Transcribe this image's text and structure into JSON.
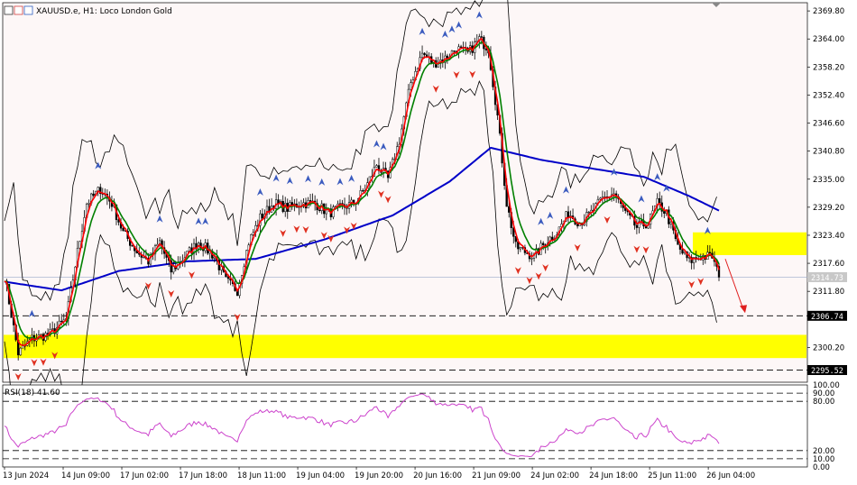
{
  "header": {
    "symbol_title": "XAUUSD.e, H1:  Loco London Gold"
  },
  "colors": {
    "price_bg": "#fdf7f7",
    "bull_candle": "#000000",
    "ma_fast": "#ff0000",
    "ma_slow": "#008000",
    "ma_long": "#0000c8",
    "bands": "#000000",
    "zone": "#ffff00",
    "rsi_line": "#cc44cc",
    "fractal_up": "#3b5bbf",
    "fractal_down": "#e03020",
    "forecast_arrow": "#e02020"
  },
  "chart_data": {
    "type": "candlestick",
    "symbol": "XAUUSD.e",
    "timeframe": "H1",
    "title": "Loco London Gold",
    "ylim": [
      2293.0,
      2371.5
    ],
    "y_ticks": [
      "2369.80",
      "2364.00",
      "2358.20",
      "2352.40",
      "2346.60",
      "2340.80",
      "2335.00",
      "2329.20",
      "2323.40",
      "2317.60",
      "2311.80",
      "2300.20"
    ],
    "x_ticks": [
      "13 Jun 2024",
      "14 Jun 09:00",
      "17 Jun 02:00",
      "17 Jun 18:00",
      "18 Jun 11:00",
      "19 Jun 04:00",
      "19 Jun 20:00",
      "20 Jun 16:00",
      "21 Jun 09:00",
      "24 Jun 02:00",
      "24 Jun 18:00",
      "25 Jun 11:00",
      "26 Jun 04:00"
    ],
    "current_price": "2314.73",
    "horizontal_levels": [
      {
        "label": "2306.74",
        "value": 2306.74,
        "style": "dashed"
      },
      {
        "label": "2295.52",
        "value": 2295.52,
        "style": "dashed"
      }
    ],
    "zones": [
      {
        "from": 2298.0,
        "to": 2302.8
      },
      {
        "from": 2319.3,
        "to": 2324.0
      }
    ],
    "price_path": [
      [
        0,
        2315.0
      ],
      [
        6,
        2299.0
      ],
      [
        12,
        2302.0
      ],
      [
        20,
        2303.0
      ],
      [
        27,
        2306.0
      ],
      [
        32,
        2320.0
      ],
      [
        36,
        2330.0
      ],
      [
        42,
        2333.0
      ],
      [
        47,
        2330.0
      ],
      [
        52,
        2324.0
      ],
      [
        58,
        2320.0
      ],
      [
        63,
        2318.0
      ],
      [
        68,
        2322.0
      ],
      [
        73,
        2316.0
      ],
      [
        79,
        2319.0
      ],
      [
        85,
        2322.0
      ],
      [
        92,
        2319.0
      ],
      [
        97,
        2314.0
      ],
      [
        102,
        2312.0
      ],
      [
        107,
        2322.0
      ],
      [
        112,
        2327.0
      ],
      [
        118,
        2330.0
      ],
      [
        124,
        2329.0
      ],
      [
        130,
        2330.0
      ],
      [
        136,
        2330.0
      ],
      [
        142,
        2328.0
      ],
      [
        147,
        2329.0
      ],
      [
        153,
        2330.0
      ],
      [
        158,
        2333.0
      ],
      [
        163,
        2338.0
      ],
      [
        168,
        2335.0
      ],
      [
        173,
        2343.0
      ],
      [
        178,
        2355.0
      ],
      [
        183,
        2361.0
      ],
      [
        188,
        2359.0
      ],
      [
        193,
        2360.0
      ],
      [
        198,
        2362.0
      ],
      [
        203,
        2361.0
      ],
      [
        208,
        2364.0
      ],
      [
        212,
        2362.0
      ],
      [
        216,
        2348.0
      ],
      [
        220,
        2330.0
      ],
      [
        224,
        2321.0
      ],
      [
        228,
        2320.0
      ],
      [
        232,
        2319.0
      ],
      [
        237,
        2322.0
      ],
      [
        242,
        2324.0
      ],
      [
        247,
        2328.0
      ],
      [
        252,
        2326.0
      ],
      [
        257,
        2328.0
      ],
      [
        262,
        2331.0
      ],
      [
        267,
        2332.0
      ],
      [
        272,
        2328.0
      ],
      [
        277,
        2325.0
      ],
      [
        282,
        2326.0
      ],
      [
        286,
        2330.0
      ],
      [
        290,
        2328.0
      ],
      [
        295,
        2321.0
      ],
      [
        300,
        2318.0
      ],
      [
        305,
        2319.0
      ],
      [
        310,
        2319.0
      ],
      [
        313,
        2314.7
      ]
    ],
    "bollinger_width": 7.0,
    "ma_long_path": [
      [
        0,
        2313.8
      ],
      [
        25,
        2312.0
      ],
      [
        50,
        2316.0
      ],
      [
        80,
        2318.0
      ],
      [
        110,
        2318.5
      ],
      [
        140,
        2322.5
      ],
      [
        170,
        2327.5
      ],
      [
        195,
        2334.5
      ],
      [
        213,
        2341.5
      ],
      [
        235,
        2339.0
      ],
      [
        260,
        2337.0
      ],
      [
        280,
        2335.5
      ],
      [
        300,
        2331.5
      ],
      [
        313,
        2328.5
      ]
    ],
    "rsi": {
      "period": 18,
      "label": "RSI(18) 41.60",
      "ylim": [
        0,
        100
      ],
      "ticks": [
        "100.00",
        "90.00",
        "80.00",
        "20.00",
        "10.00",
        "0.00"
      ],
      "levels": [
        90,
        80,
        20,
        10
      ]
    }
  }
}
